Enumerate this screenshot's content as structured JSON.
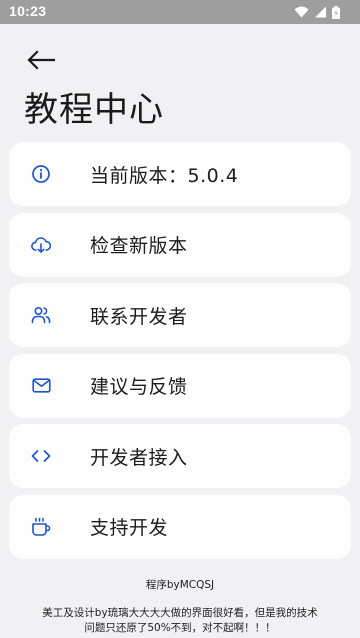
{
  "status_bar": {
    "time": "10:23",
    "icons": [
      "wifi-icon",
      "signal-icon",
      "battery-icon"
    ]
  },
  "header": {
    "back_icon": "arrow-left-icon",
    "title": "教程中心"
  },
  "menu": {
    "items": [
      {
        "label": "当前版本：5.0.4",
        "icon": "info-icon"
      },
      {
        "label": "检查新版本",
        "icon": "cloud-download-icon"
      },
      {
        "label": "联系开发者",
        "icon": "people-icon"
      },
      {
        "label": "建议与反馈",
        "icon": "mail-icon"
      },
      {
        "label": "开发者接入",
        "icon": "code-icon"
      },
      {
        "label": "支持开发",
        "icon": "coffee-icon"
      }
    ]
  },
  "footer": {
    "credit": "程序byMCQSJ",
    "note": "美工及设计by琉璃大大大大做的界面很好看，但是我的技术问题只还原了50%不到，对不起啊！！！"
  },
  "colors": {
    "accent": "#1f56c4",
    "background": "#f1f1f3",
    "card": "#fdfdfd",
    "status_bar": "#9e9e9e"
  }
}
